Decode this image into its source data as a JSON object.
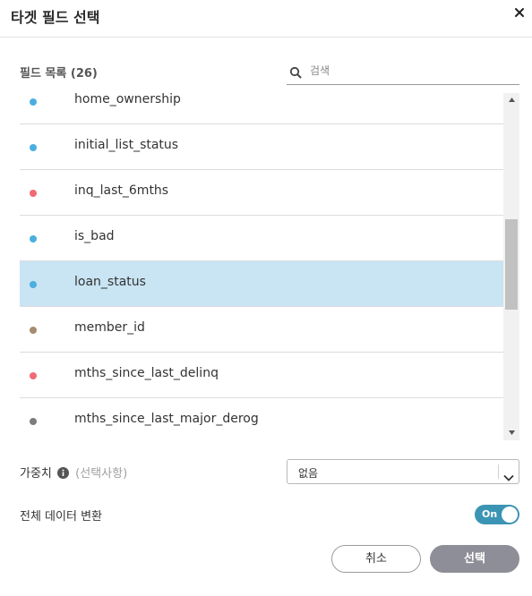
{
  "dialog": {
    "title": "타겟 필드 선택",
    "close_icon": "close-icon"
  },
  "field_list": {
    "label": "필드 목록 (26)",
    "search_placeholder": "검색",
    "search_value": "",
    "items": [
      {
        "name": "home_ownership",
        "dot_color": "#4aafe0",
        "selected": false
      },
      {
        "name": "initial_list_status",
        "dot_color": "#4aafe0",
        "selected": false
      },
      {
        "name": "inq_last_6mths",
        "dot_color": "#f06b74",
        "selected": false
      },
      {
        "name": "is_bad",
        "dot_color": "#4aafe0",
        "selected": false
      },
      {
        "name": "loan_status",
        "dot_color": "#4aafe0",
        "selected": true
      },
      {
        "name": "member_id",
        "dot_color": "#a78b6f",
        "selected": false
      },
      {
        "name": "mths_since_last_delinq",
        "dot_color": "#f06b74",
        "selected": false
      },
      {
        "name": "mths_since_last_major_derog",
        "dot_color": "#7c7c7c",
        "selected": false
      }
    ]
  },
  "weight": {
    "label": "가중치",
    "optional_label": "(선택사항)",
    "selected_value": "없음"
  },
  "transform": {
    "label": "전체 데이터 변환",
    "toggle_text": "On",
    "enabled": true
  },
  "buttons": {
    "cancel_label": "취소",
    "select_label": "선택"
  },
  "colors": {
    "selected_row": "#c9e4f3",
    "toggle_on": "#3c94b4",
    "primary_button": "#8e8e98"
  }
}
